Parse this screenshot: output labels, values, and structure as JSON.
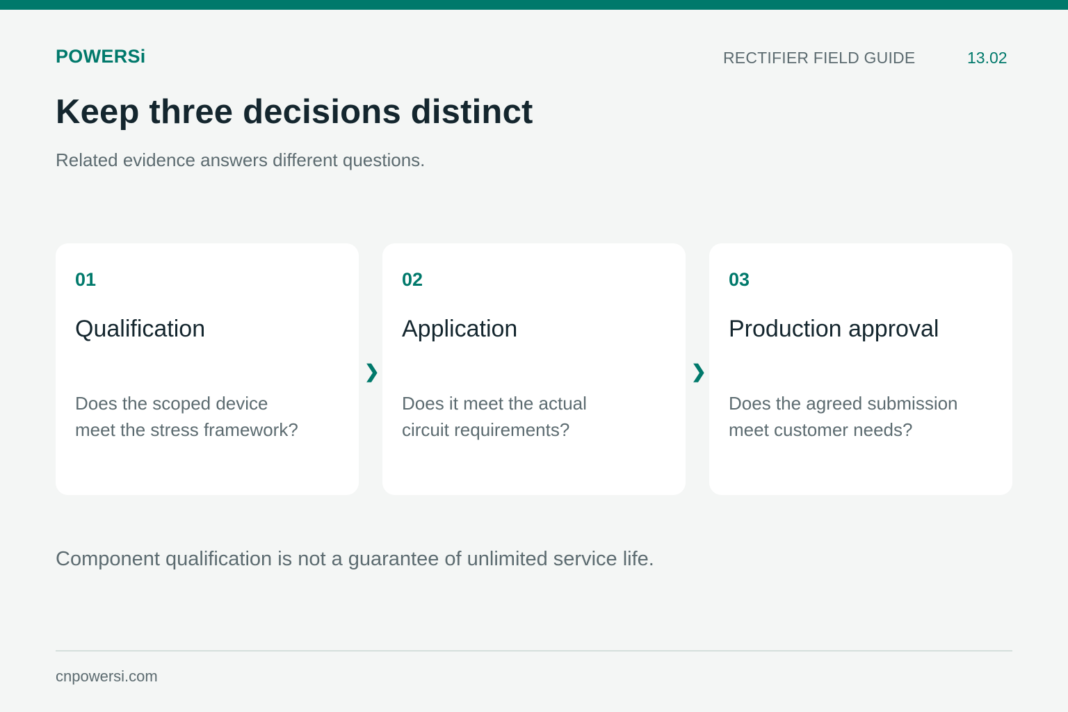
{
  "header": {
    "brand": "POWERSi",
    "guide_label": "RECTIFIER FIELD GUIDE",
    "page_number": "13.02"
  },
  "main": {
    "title": "Keep three decisions distinct",
    "subtitle": "Related evidence answers different questions."
  },
  "steps": [
    {
      "number": "01",
      "title": "Qualification",
      "question": "Does the scoped device meet the stress framework?"
    },
    {
      "number": "02",
      "title": "Application",
      "question": "Does it meet the actual circuit requirements?"
    },
    {
      "number": "03",
      "title": "Production approval",
      "question": "Does the agreed submission meet customer needs?"
    }
  ],
  "arrow_glyph": "❯",
  "footnote": "Component qualification is not a guarantee of unlimited service life.",
  "footer": {
    "site": "cnpowersi.com"
  },
  "colors": {
    "accent": "#00796b",
    "background": "#f4f6f5",
    "card": "#ffffff",
    "heading": "#14262e",
    "muted": "#5c6b70"
  }
}
